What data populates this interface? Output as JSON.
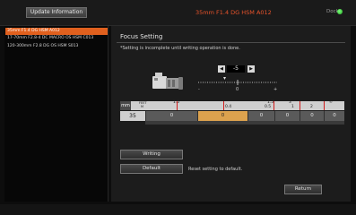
{
  "header": {
    "update_label": "Update Information",
    "title": "35mm F1.4 DG HSM A012",
    "dock_label": "Dock",
    "dock_color": "#33cc33"
  },
  "sidebar": {
    "items": [
      {
        "label": "35mm F1.4 DG HSM A012",
        "selected": true
      },
      {
        "label": "17-70mm F2.8-4 DC MACRO OS HSM C013",
        "selected": false
      },
      {
        "label": "120-300mm F2.8 DG OS HSM S013",
        "selected": false
      }
    ]
  },
  "main": {
    "heading": "Focus Setting",
    "note": "*Setting is incomplete until writing operation is done.",
    "offset": {
      "decrease_label": "◀",
      "value": "-5",
      "increase_label": "▶",
      "ruler_labels": [
        "-",
        "0",
        "+"
      ]
    },
    "scale": {
      "unit_label": "mm",
      "ft_label": "FEET",
      "m_label": "M",
      "ticks": [
        "1.5",
        "0.4",
        "1.5",
        "0.5",
        "3",
        "1",
        "2",
        "∞"
      ],
      "focal_length": "35",
      "segment_values": [
        "0",
        "0",
        "0",
        "0",
        "0",
        "0"
      ],
      "active_segment": 1
    },
    "buttons": {
      "writing": "Writing",
      "default": "Default",
      "default_hint": "Reset setting to default.",
      "return": "Return"
    }
  }
}
